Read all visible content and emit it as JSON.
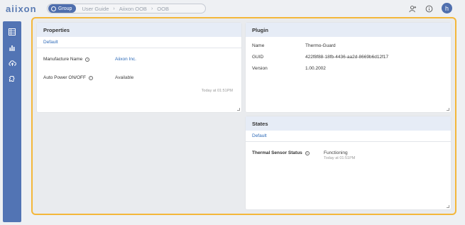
{
  "brand": {
    "logo": "aiixon"
  },
  "breadcrumb": {
    "group_label": "Group",
    "items": [
      "User Guide",
      "Aiixon OOB",
      "OOB"
    ]
  },
  "user": {
    "avatar_initial": "h"
  },
  "properties": {
    "title": "Properties",
    "tab": "Default",
    "rows": [
      {
        "label": "Manufacture Name",
        "value": "Aiixon Inc."
      },
      {
        "label": "Auto Power ON/OFF",
        "value": "Available"
      }
    ],
    "timestamp": "Today at 01:51PM"
  },
  "plugin": {
    "title": "Plugin",
    "rows": [
      {
        "label": "Name",
        "value": "Thermo-Guard"
      },
      {
        "label": "GUID",
        "value": "422f8f88-18fb-4436-aa2d-8669b6d12f17"
      },
      {
        "label": "Version",
        "value": "1.00.2002"
      }
    ]
  },
  "states": {
    "title": "States",
    "tab": "Default",
    "rows": [
      {
        "label": "Thermal Sensor Status",
        "value": "Functioning",
        "timestamp": "Today at 01:51PM"
      }
    ]
  },
  "colors": {
    "accent": "#4f6fae",
    "frame_border": "#f4b73a",
    "sidebar": "#5274b4",
    "panel_header": "#e6ecf6",
    "link": "#2d6ab8"
  }
}
